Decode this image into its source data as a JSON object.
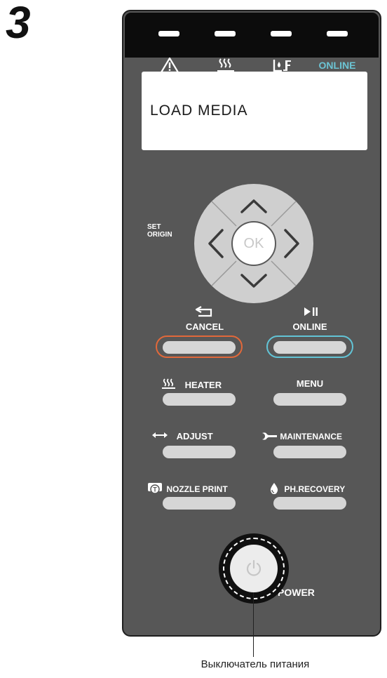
{
  "step_number": "3",
  "indicators": {
    "warning": "warning-triangle-icon",
    "heater": "heater-icon",
    "ink": "ink-icon",
    "online_label": "ONLINE",
    "online_color": "#6cc4d4"
  },
  "lcd": {
    "text": "LOAD MEDIA"
  },
  "dpad": {
    "ok_label": "OK",
    "side_label_line1": "SET",
    "side_label_line2": "ORIGIN"
  },
  "buttons": {
    "cancel_label": "CANCEL",
    "online_label": "ONLINE",
    "heater_label": "HEATER",
    "menu_label": "MENU",
    "adjust_label": "ADJUST",
    "maintenance_label": "MAINTENANCE",
    "nozzle_print_label": "NOZZLE PRINT",
    "ph_recovery_label": "PH.RECOVERY",
    "power_label": "POWER"
  },
  "colors": {
    "panel": "#575757",
    "cancel_ring": "#e2683a",
    "online_ring": "#62c4d6"
  },
  "callout": {
    "text": "Выключатель питания"
  }
}
